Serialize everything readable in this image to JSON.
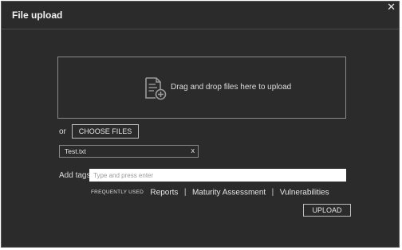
{
  "dialog": {
    "title": "File upload",
    "close_glyph": "✕"
  },
  "dropzone": {
    "text": "Drag and drop files here to upload",
    "icon": "file-add-icon"
  },
  "chooser": {
    "or_label": "or",
    "choose_label": "CHOOSE FILES"
  },
  "files": [
    {
      "name": "Test.txt",
      "remove_glyph": "x"
    }
  ],
  "tags": {
    "label": "Add tags",
    "placeholder": "Type and press enter",
    "frequently_used_label": "FREQUENTLY USED",
    "frequently_used": [
      "Reports",
      "Maturity Assessment",
      "Vulnerabilities"
    ],
    "separator": "|"
  },
  "actions": {
    "upload_label": "UPLOAD"
  }
}
